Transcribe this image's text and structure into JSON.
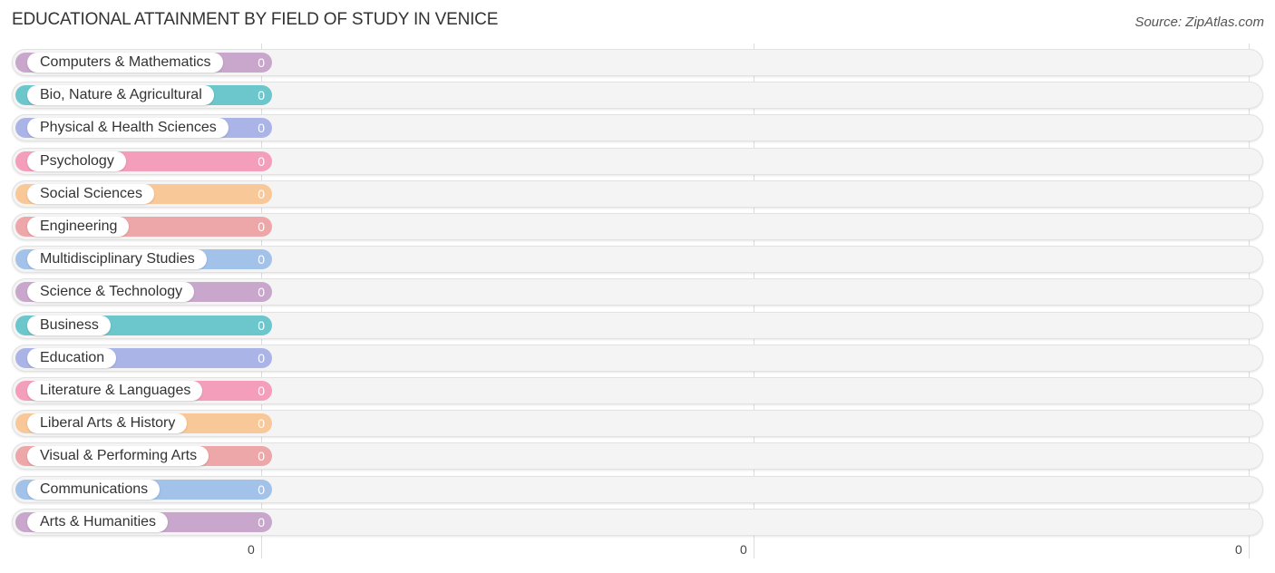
{
  "chart_data": {
    "type": "bar",
    "orientation": "horizontal",
    "title": "EDUCATIONAL ATTAINMENT BY FIELD OF STUDY IN VENICE",
    "source": "Source: ZipAtlas.com",
    "xlabel": "",
    "ylabel": "",
    "categories": [
      "Computers & Mathematics",
      "Bio, Nature & Agricultural",
      "Physical & Health Sciences",
      "Psychology",
      "Social Sciences",
      "Engineering",
      "Multidisciplinary Studies",
      "Science & Technology",
      "Business",
      "Education",
      "Literature & Languages",
      "Liberal Arts & History",
      "Visual & Performing Arts",
      "Communications",
      "Arts & Humanities"
    ],
    "values": [
      0,
      0,
      0,
      0,
      0,
      0,
      0,
      0,
      0,
      0,
      0,
      0,
      0,
      0,
      0
    ],
    "value_labels": [
      "0",
      "0",
      "0",
      "0",
      "0",
      "0",
      "0",
      "0",
      "0",
      "0",
      "0",
      "0",
      "0",
      "0",
      "0"
    ],
    "colors": [
      "#c9a7cc",
      "#6cc7cc",
      "#aab4e6",
      "#f59ebb",
      "#f9c898",
      "#eea7a8",
      "#a3c2ea",
      "#c9a7cc",
      "#6cc7cc",
      "#aab4e6",
      "#f59ebb",
      "#f9c898",
      "#eea7a8",
      "#a3c2ea",
      "#c9a7cc"
    ],
    "x_tick_labels": [
      "0",
      "0",
      "0"
    ],
    "xlim": [
      0,
      0
    ],
    "grid": true,
    "legend": "none"
  }
}
